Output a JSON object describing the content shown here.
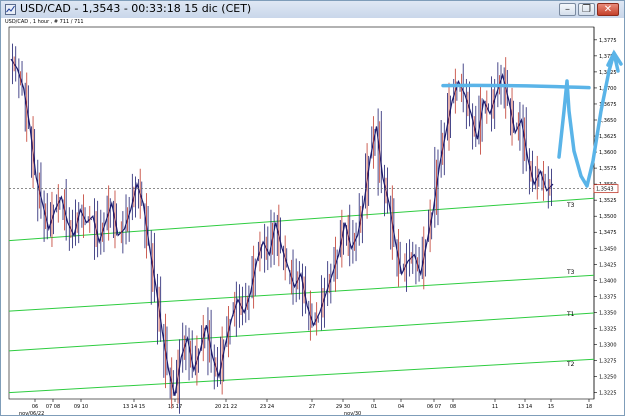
{
  "window": {
    "title": "USD/CAD - 1,3543 - 00:33:18  15 dic (CET)",
    "minimize_glyph": "–",
    "maximize_glyph": "❐",
    "close_glyph": "✕",
    "icon": "chart-window-icon"
  },
  "chart_info": "USD/CAD , 1 hour , # 711 / 711",
  "colors": {
    "candle": "#1c1c6e",
    "candle_accent": "#c0392b",
    "trendline": "#2ecc40",
    "annotation": "#5ab4e8",
    "current_price_line": "#666666",
    "price_badge": "#c0392b"
  },
  "chart_data": {
    "type": "line",
    "instrument": "USD/CAD",
    "ylim": [
      1.3215,
      1.3795
    ],
    "yticks": [
      "1,3775",
      "1,3750",
      "1,3725",
      "1,3700",
      "1,3675",
      "1,3650",
      "1,3625",
      "1,3600",
      "1,3575",
      "1,3550",
      "1,3525",
      "1,3500",
      "1,3475",
      "1,3450",
      "1,3425",
      "1,3400",
      "1,3375",
      "1,3350",
      "1,3325",
      "1,3300",
      "1,3275",
      "1,3250",
      "1,3225"
    ],
    "xticks": [
      "06",
      "07 08",
      "09 10",
      "13 14 15",
      "16 17",
      "20 21 22",
      "23 24",
      "27",
      "29 30",
      "01",
      "04",
      "06 07",
      "08",
      "11",
      "13 14",
      "15",
      "18"
    ],
    "xticks_secondary": [
      "nov/06/22",
      "nov/30"
    ],
    "current_price": 1.3543,
    "current_price_label": "1,3543",
    "price": [
      1.3745,
      1.373,
      1.37,
      1.364,
      1.356,
      1.352,
      1.348,
      1.351,
      1.353,
      1.349,
      1.347,
      1.351,
      1.349,
      1.35,
      1.346,
      1.349,
      1.352,
      1.347,
      1.348,
      1.351,
      1.355,
      1.352,
      1.345,
      1.339,
      1.332,
      1.326,
      1.322,
      1.328,
      1.331,
      1.326,
      1.329,
      1.333,
      1.328,
      1.325,
      1.33,
      1.334,
      1.337,
      1.335,
      1.338,
      1.343,
      1.346,
      1.344,
      1.349,
      1.345,
      1.342,
      1.339,
      1.341,
      1.336,
      1.333,
      1.335,
      1.338,
      1.341,
      1.344,
      1.349,
      1.345,
      1.347,
      1.352,
      1.359,
      1.364,
      1.356,
      1.352,
      1.346,
      1.341,
      1.343,
      1.344,
      1.341,
      1.346,
      1.351,
      1.358,
      1.363,
      1.368,
      1.371,
      1.369,
      1.366,
      1.362,
      1.368,
      1.366,
      1.369,
      1.372,
      1.368,
      1.363,
      1.365,
      1.359,
      1.355,
      1.357,
      1.354,
      1.355
    ],
    "trendlines": [
      {
        "name": "T3",
        "y_start": 1.3462,
        "y_end": 1.3528
      },
      {
        "name": "T3",
        "y_start": 1.3352,
        "y_end": 1.3408
      },
      {
        "name": "T1",
        "y_start": 1.329,
        "y_end": 1.3349
      },
      {
        "name": "T2",
        "y_start": 1.3225,
        "y_end": 1.3277
      }
    ],
    "trendline_labels": [
      "T3",
      "T3",
      "T1",
      "T2"
    ],
    "annotations": [
      {
        "type": "horizontal-stroke",
        "y": 1.3702
      },
      {
        "type": "arrow-up",
        "shape": "freehand"
      }
    ]
  }
}
